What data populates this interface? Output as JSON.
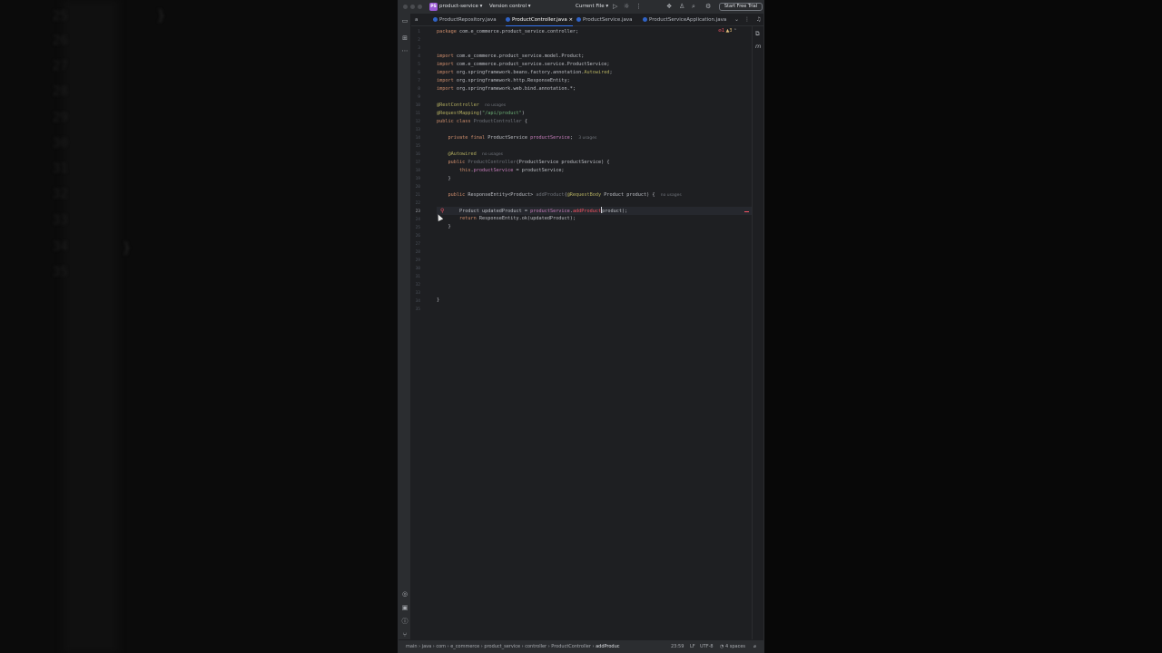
{
  "background": {
    "left_lines": [
      "25",
      "26",
      "27",
      "28",
      "29",
      "30",
      "31",
      "32",
      "33",
      "34",
      "35"
    ],
    "braces": [
      "}",
      "}"
    ]
  },
  "titlebar": {
    "project_badge": "PS",
    "project_name": "product-service",
    "version_control": "Version control",
    "run_config": "Current File",
    "trial_button": "Start Free Trial"
  },
  "tabs": [
    {
      "label": "ProductRepository.java",
      "active": false
    },
    {
      "label": "ProductController.java",
      "active": true
    },
    {
      "label": "ProductService.java",
      "active": false
    },
    {
      "label": "ProductServiceApplication.java",
      "active": false
    }
  ],
  "tabbar_prefix": "a",
  "inspections": {
    "errors": "1",
    "warnings": "3"
  },
  "editor": {
    "line_numbers": [
      "1",
      "2",
      "3",
      "4",
      "5",
      "6",
      "7",
      "8",
      "9",
      "10",
      "11",
      "12",
      "13",
      "14",
      "15",
      "16",
      "17",
      "18",
      "19",
      "20",
      "21",
      "22",
      "23",
      "24",
      "25",
      "26",
      "27",
      "28",
      "29",
      "30",
      "31",
      "32",
      "33",
      "34",
      "35"
    ],
    "current_line": "23",
    "lines": {
      "l1_kw": "package",
      "l1": " com.e_commerce.product_service.controller;",
      "l4_kw": "import",
      "l4": " com.e_commerce.product_service.model.Product;",
      "l5_kw": "import",
      "l5": " com.e_commerce.product_service.service.ProductService;",
      "l6_kw": "import",
      "l6": " org.springframework.beans.factory.annotation.",
      "l6_an": "Autowired",
      "l6_end": ";",
      "l7_kw": "import",
      "l7": " org.springframework.http.ResponseEntity;",
      "l8_kw": "import",
      "l8": " org.springframework.web.bind.annotation.*;",
      "l10_an": "@RestController",
      "l10_hint": "no usages",
      "l11_an": "@RequestMapping",
      "l11_a": "(",
      "l11_st": "\"/api/product\"",
      "l11_b": ")",
      "l12_kw": "public class",
      "l12_name": " ProductController",
      "l12_end": " {",
      "l14_kw": "    private final",
      "l14_type": " ProductService ",
      "l14_fd": "productService",
      "l14_end": ";",
      "l14_hint": "3 usages",
      "l16_an": "    @Autowired",
      "l16_hint": "no usages",
      "l17_kw": "    public",
      "l17_name": " ProductController",
      "l17_rest": "(ProductService productService) {",
      "l18_kw": "        this",
      "l18_a": ".",
      "l18_fd": "productService",
      "l18_rest": " = productService;",
      "l19": "    }",
      "l21_kw": "    public",
      "l21_type": " ResponseEntity<Product> ",
      "l21_fn": "addProduct",
      "l21_a": "(",
      "l21_an": "@RequestBody",
      "l21_rest": " Product product) {",
      "l21_hint": "no usages",
      "l23_a": "        Product updatedProduct = ",
      "l23_fd": "productService",
      "l23_b": ".",
      "l23_err": "addProduct",
      "l23_c": "product);",
      "l24_kw": "        return",
      "l24_rest": " ResponseEntity.ok(updatedProduct);",
      "l25": "    }",
      "l33": "}"
    }
  },
  "statusbar": {
    "breadcrumb": [
      "main",
      "java",
      "com",
      "e_commerce",
      "product_service",
      "controller",
      "ProductController",
      "addProduc"
    ],
    "position": "23:59",
    "line_sep": "LF",
    "encoding": "UTF-8",
    "indent": "4 spaces"
  },
  "colors": {
    "editor_bg": "#1e1f22",
    "panel_bg": "#2b2d30",
    "accent": "#3574f0",
    "keyword": "#cf8e6d",
    "annotation": "#b3ae60",
    "string": "#6aab73",
    "field": "#c77dbb",
    "error": "#f75464"
  },
  "icons": [
    "folder-icon",
    "structure-icon",
    "more-icon",
    "git-icon",
    "terminal-icon",
    "problems-icon",
    "vcs-icon",
    "bell-icon",
    "search-icon",
    "settings-icon",
    "account-icon",
    "run-icon",
    "debug-icon"
  ]
}
